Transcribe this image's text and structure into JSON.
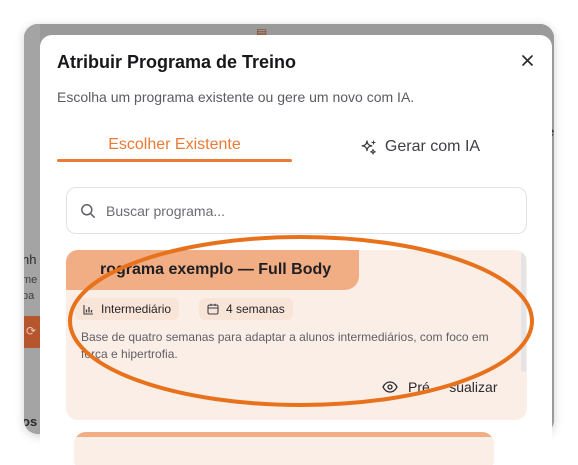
{
  "background": {
    "partial_texts": [
      "nh",
      "me",
      "pa",
      "os",
      "e"
    ]
  },
  "modal": {
    "title": "Atribuir Programa de Treino",
    "subtitle": "Escolha um programa existente ou gere um novo com IA.",
    "tabs": [
      {
        "label": "Escolher Existente",
        "active": true,
        "icon": ""
      },
      {
        "label": "Gerar com IA",
        "active": false,
        "icon": "sparkles-icon"
      }
    ],
    "close_icon": "close-icon"
  },
  "search": {
    "placeholder": "Buscar programa...",
    "icon": "search-icon"
  },
  "programs": [
    {
      "title": "Programa exemplo — Full Body",
      "title_visible": "rograma exemplo — Full Body",
      "level": "Intermediário",
      "duration": "4 semanas",
      "description": "Base de quatro semanas para adaptar a alunos intermediários, com foco em força e hipertrofia.",
      "preview_label": "Pré-visualizar",
      "preview_visible": "Pré     sualizar"
    }
  ],
  "colors": {
    "accent": "#ea7a35",
    "card_bg": "#fbeee6",
    "card_title_bg": "#f1ad84",
    "annotation": "#e8721c"
  }
}
